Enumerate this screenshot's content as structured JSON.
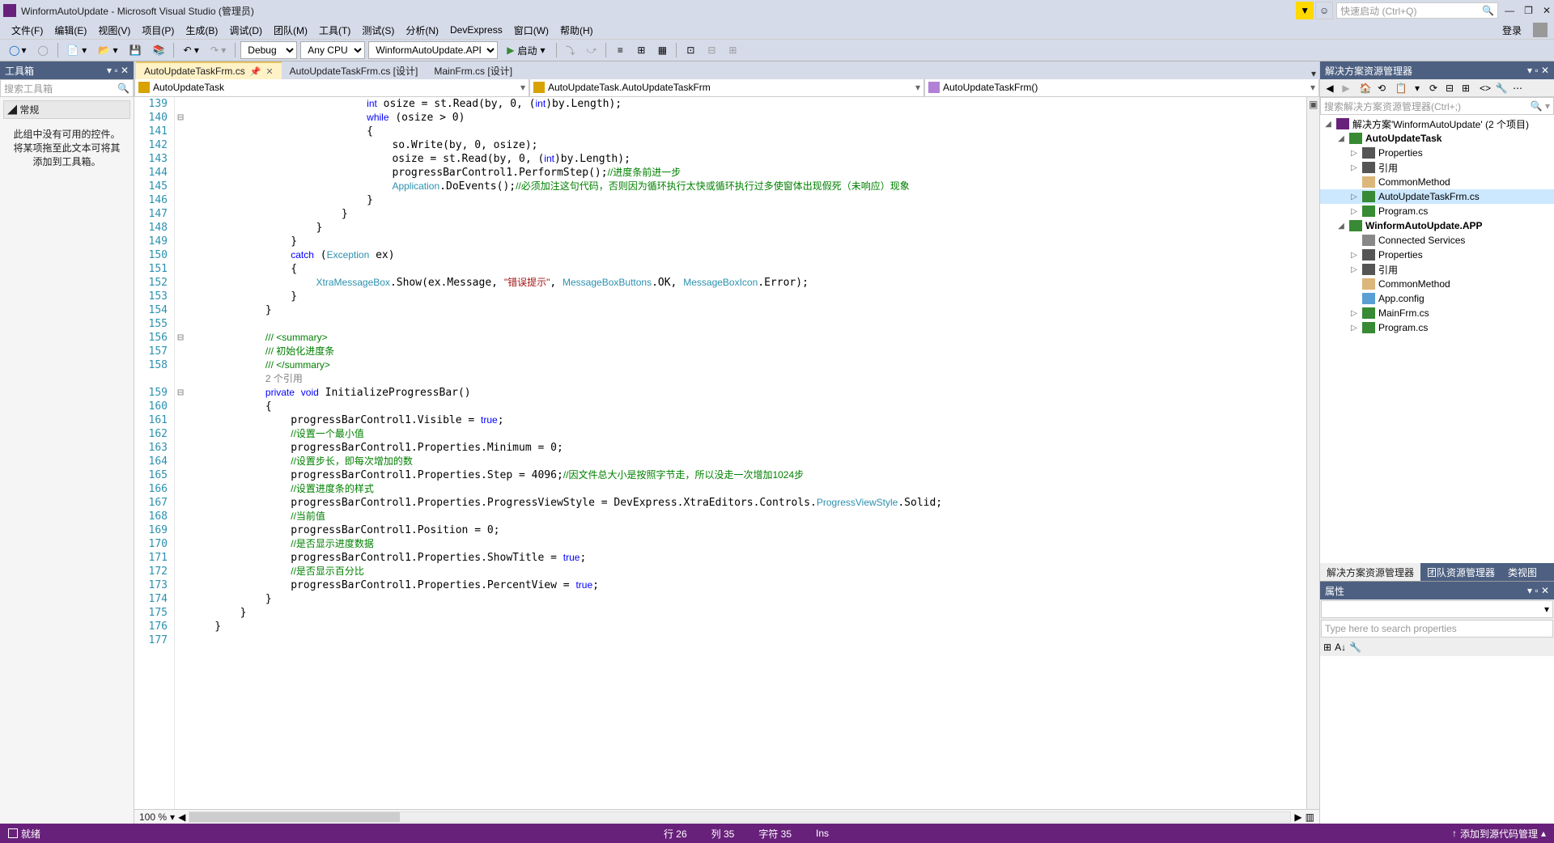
{
  "title": "WinformAutoUpdate - Microsoft Visual Studio  (管理员)",
  "quick_launch_placeholder": "快速启动 (Ctrl+Q)",
  "menus": [
    "文件(F)",
    "编辑(E)",
    "视图(V)",
    "项目(P)",
    "生成(B)",
    "调试(D)",
    "团队(M)",
    "工具(T)",
    "测试(S)",
    "分析(N)",
    "DevExpress",
    "窗口(W)",
    "帮助(H)"
  ],
  "login_label": "登录",
  "toolbar": {
    "config": "Debug",
    "platform": "Any CPU",
    "startup": "WinformAutoUpdate.APP",
    "start_label": "启动"
  },
  "toolbox": {
    "title": "工具箱",
    "search_placeholder": "搜索工具箱",
    "group_label": "常规",
    "empty_msg": "此组中没有可用的控件。将某项拖至此文本可将其添加到工具箱。"
  },
  "doc_tabs": [
    {
      "label": "AutoUpdateTaskFrm.cs",
      "active": true,
      "pinned": true,
      "closable": true
    },
    {
      "label": "AutoUpdateTaskFrm.cs [设计]",
      "active": false
    },
    {
      "label": "MainFrm.cs [设计]",
      "active": false
    }
  ],
  "nav": {
    "type_combo": "AutoUpdateTask",
    "class_combo": "AutoUpdateTask.AutoUpdateTaskFrm",
    "member_combo": "AutoUpdateTaskFrm()"
  },
  "line_start": 139,
  "line_end": 177,
  "zoom": "100 %",
  "solution_explorer": {
    "title": "解决方案资源管理器",
    "search_placeholder": "搜索解决方案资源管理器(Ctrl+;)",
    "solution_label": "解决方案'WinformAutoUpdate' (2 个项目)",
    "tree": [
      {
        "d": 0,
        "arrow": "◢",
        "icon": "sln-icon",
        "label": "解决方案'WinformAutoUpdate' (2 个项目)",
        "bind": "solution_explorer.solution_label"
      },
      {
        "d": 1,
        "arrow": "◢",
        "icon": "csproj-icon",
        "label": "AutoUpdateTask",
        "bold": true
      },
      {
        "d": 2,
        "arrow": "▷",
        "icon": "props-icon",
        "label": "Properties"
      },
      {
        "d": 2,
        "arrow": "▷",
        "icon": "ref-icon",
        "label": "引用"
      },
      {
        "d": 2,
        "arrow": "",
        "icon": "folder-icon",
        "label": "CommonMethod"
      },
      {
        "d": 2,
        "arrow": "▷",
        "icon": "cs-icon",
        "label": "AutoUpdateTaskFrm.cs",
        "sel": true
      },
      {
        "d": 2,
        "arrow": "▷",
        "icon": "cs-icon",
        "label": "Program.cs"
      },
      {
        "d": 1,
        "arrow": "◢",
        "icon": "csproj-icon",
        "label": "WinformAutoUpdate.APP",
        "bold": true
      },
      {
        "d": 2,
        "arrow": "",
        "icon": "conn-icon",
        "label": "Connected Services"
      },
      {
        "d": 2,
        "arrow": "▷",
        "icon": "props-icon",
        "label": "Properties"
      },
      {
        "d": 2,
        "arrow": "▷",
        "icon": "ref-icon",
        "label": "引用"
      },
      {
        "d": 2,
        "arrow": "",
        "icon": "folder-icon",
        "label": "CommonMethod"
      },
      {
        "d": 2,
        "arrow": "",
        "icon": "config-icon",
        "label": "App.config"
      },
      {
        "d": 2,
        "arrow": "▷",
        "icon": "cs-icon",
        "label": "MainFrm.cs"
      },
      {
        "d": 2,
        "arrow": "▷",
        "icon": "cs-icon",
        "label": "Program.cs"
      }
    ],
    "bottom_tabs": [
      "解决方案资源管理器",
      "团队资源管理器",
      "类视图"
    ]
  },
  "properties": {
    "title": "属性",
    "search_placeholder": "Type here to search properties"
  },
  "status": {
    "ready": "就绪",
    "line_label": "行 26",
    "col_label": "列 35",
    "char_label": "字符 35",
    "ins": "Ins",
    "scm": "添加到源代码管理"
  },
  "code_lines": [
    {
      "n": 139,
      "html": "                            <span class='kw'>int</span> osize = st.Read(by, 0, (<span class='kw'>int</span>)by.Length);"
    },
    {
      "n": 140,
      "fold": "⊟",
      "html": "                            <span class='kw'>while</span> (osize > 0)"
    },
    {
      "n": 141,
      "html": "                            {"
    },
    {
      "n": 142,
      "html": "                                so.Write(by, 0, osize);"
    },
    {
      "n": 143,
      "html": "                                osize = st.Read(by, 0, (<span class='kw'>int</span>)by.Length);"
    },
    {
      "n": 144,
      "html": "                                progressBarControl1.PerformStep();<span class='cmt'>//进度条前进一步</span>"
    },
    {
      "n": 145,
      "html": "                                <span class='type'>Application</span>.DoEvents();<span class='cmt'>//必须加注这句代码，否则因为循环执行太快或循环执行过多使窗体出现假死（未响应）现象</span>"
    },
    {
      "n": 146,
      "html": "                            }"
    },
    {
      "n": 147,
      "html": "                        }"
    },
    {
      "n": 148,
      "html": "                    }"
    },
    {
      "n": 149,
      "html": "                }"
    },
    {
      "n": 150,
      "html": "                <span class='kw'>catch</span> (<span class='type'>Exception</span> ex)"
    },
    {
      "n": 151,
      "html": "                {"
    },
    {
      "n": 152,
      "html": "                    <span class='type'>XtraMessageBox</span>.Show(ex.Message, <span class='str'>\"错误提示\"</span>, <span class='type'>MessageBoxButtons</span>.OK, <span class='type'>MessageBoxIcon</span>.Error);"
    },
    {
      "n": 153,
      "html": "                }"
    },
    {
      "n": 154,
      "html": "            }"
    },
    {
      "n": 155,
      "html": ""
    },
    {
      "n": 156,
      "fold": "⊟",
      "html": "            <span class='cmt'>/// &lt;summary&gt;</span>"
    },
    {
      "n": 157,
      "html": "            <span class='cmt'>/// 初始化进度条</span>"
    },
    {
      "n": 158,
      "html": "            <span class='cmt'>/// &lt;/summary&gt;</span>"
    },
    {
      "n": null,
      "html": "            <span class='ref'>2 个引用</span>"
    },
    {
      "n": 159,
      "fold": "⊟",
      "html": "            <span class='kw'>private</span> <span class='kw'>void</span> InitializeProgressBar()"
    },
    {
      "n": 160,
      "html": "            {"
    },
    {
      "n": 161,
      "html": "                progressBarControl1.Visible = <span class='kw'>true</span>;"
    },
    {
      "n": 162,
      "html": "                <span class='cmt'>//设置一个最小值</span>"
    },
    {
      "n": 163,
      "html": "                progressBarControl1.Properties.Minimum = 0;"
    },
    {
      "n": 164,
      "html": "                <span class='cmt'>//设置步长，即每次增加的数</span>"
    },
    {
      "n": 165,
      "html": "                progressBarControl1.Properties.Step = 4096;<span class='cmt'>//因文件总大小是按照字节走，所以没走一次增加1024步</span>"
    },
    {
      "n": 166,
      "html": "                <span class='cmt'>//设置进度条的样式</span>"
    },
    {
      "n": 167,
      "html": "                progressBarControl1.Properties.ProgressViewStyle = DevExpress.XtraEditors.Controls.<span class='type'>ProgressViewStyle</span>.Solid;"
    },
    {
      "n": 168,
      "html": "                <span class='cmt'>//当前值</span>"
    },
    {
      "n": 169,
      "html": "                progressBarControl1.Position = 0;"
    },
    {
      "n": 170,
      "html": "                <span class='cmt'>//是否显示进度数据</span>"
    },
    {
      "n": 171,
      "html": "                progressBarControl1.Properties.ShowTitle = <span class='kw'>true</span>;"
    },
    {
      "n": 172,
      "html": "                <span class='cmt'>//是否显示百分比</span>"
    },
    {
      "n": 173,
      "html": "                progressBarControl1.Properties.PercentView = <span class='kw'>true</span>;"
    },
    {
      "n": 174,
      "html": "            }"
    },
    {
      "n": 175,
      "html": "        }"
    },
    {
      "n": 176,
      "html": "    }"
    },
    {
      "n": 177,
      "html": ""
    }
  ]
}
